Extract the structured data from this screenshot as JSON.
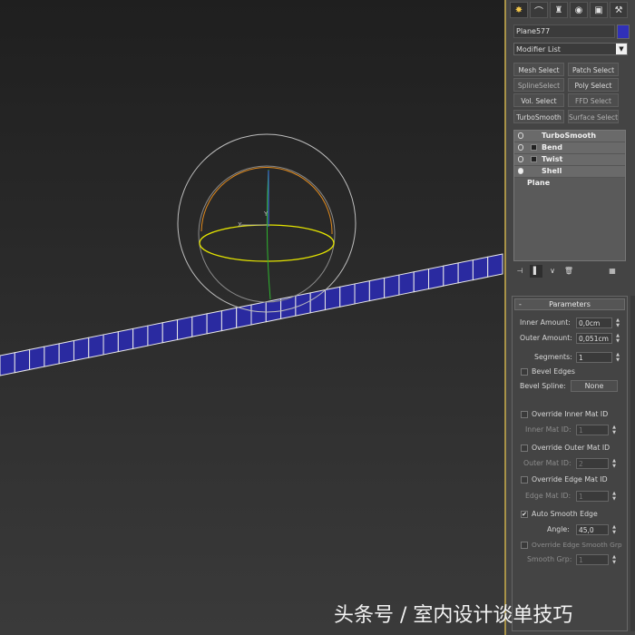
{
  "tabs": [
    {
      "icon": "create-icon",
      "glyph": "✸"
    },
    {
      "icon": "modify-icon",
      "glyph": "⌒"
    },
    {
      "icon": "hierarchy-icon",
      "glyph": "♜"
    },
    {
      "icon": "motion-icon",
      "glyph": "◉"
    },
    {
      "icon": "display-icon",
      "glyph": "▣"
    },
    {
      "icon": "utilities-icon",
      "glyph": "⚒"
    }
  ],
  "object": {
    "name": "Plane577",
    "color": "#3030b8"
  },
  "modifier_list": {
    "label": "Modifier List"
  },
  "modifier_buttons": [
    {
      "label": "Mesh Select",
      "enabled": true
    },
    {
      "label": "Patch Select",
      "enabled": true
    },
    {
      "label": "SplineSelect",
      "enabled": false
    },
    {
      "label": "Poly Select",
      "enabled": true
    },
    {
      "label": "Vol. Select",
      "enabled": true
    },
    {
      "label": "FFD Select",
      "enabled": false
    },
    {
      "label": "TurboSmooth",
      "enabled": true
    },
    {
      "label": "Surface Select",
      "enabled": false
    }
  ],
  "stack": [
    {
      "label": "TurboSmooth"
    },
    {
      "label": "Bend"
    },
    {
      "label": "Twist"
    },
    {
      "label": "Shell"
    },
    {
      "label": "Plane"
    }
  ],
  "stack_tools": [
    {
      "icon": "pin-stack-icon",
      "glyph": "⊣"
    },
    {
      "icon": "show-end-result-icon",
      "glyph": "▌"
    },
    {
      "icon": "make-unique-icon",
      "glyph": "∨"
    },
    {
      "icon": "remove-modifier-icon",
      "glyph": "🗑"
    },
    {
      "icon": "configure-sets-icon",
      "glyph": "▦"
    }
  ],
  "parameters": {
    "title": "Parameters",
    "inner_amount_label": "Inner Amount:",
    "inner_amount": "0,0cm",
    "outer_amount_label": "Outer Amount:",
    "outer_amount": "0,051cm",
    "segments_label": "Segments:",
    "segments": "1",
    "bevel_edges_label": "Bevel Edges",
    "bevel_spline_label": "Bevel Spline:",
    "bevel_spline_value": "None",
    "override_inner_label": "Override Inner Mat ID",
    "inner_mat_label": "Inner Mat ID:",
    "inner_mat": "1",
    "override_outer_label": "Override Outer Mat ID",
    "outer_mat_label": "Outer Mat ID:",
    "outer_mat": "2",
    "override_edge_label": "Override Edge Mat ID",
    "edge_mat_label": "Edge Mat ID:",
    "edge_mat": "1",
    "auto_smooth_label": "Auto Smooth Edge",
    "auto_smooth_checked": true,
    "angle_label": "Angle:",
    "angle": "45,0",
    "override_smooth_label": "Override Edge Smooth Grp",
    "smooth_grp_label": "Smooth Grp:",
    "smooth_grp": "1"
  },
  "viewport": {
    "gizmo_axes": {
      "y": "Y",
      "x": "X"
    },
    "strip_color": "#2a2aa0"
  },
  "watermark": "头条号 / 室内设计谈单技巧"
}
